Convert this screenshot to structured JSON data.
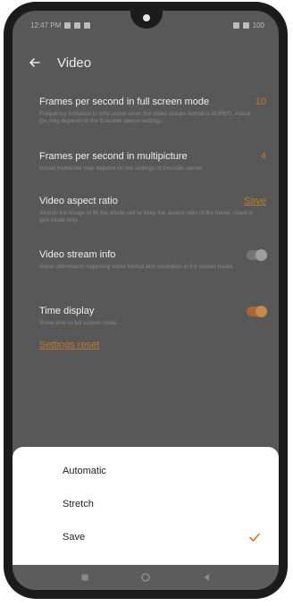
{
  "status_bar": {
    "time": "12:47 PM",
    "battery": "100"
  },
  "header": {
    "title": "Video"
  },
  "settings": [
    {
      "label": "Frames per second in full screen mode",
      "value": "10",
      "description": "Frequency limitation is only active when the video stream format is MJPEG. Actual fps may depend on the Encoder device settings."
    },
    {
      "label": "Frames per second in multipicture",
      "value": "4",
      "description": "Actual framerate may depend on the settings of Encoder server."
    },
    {
      "label": "Video aspect ratio",
      "value": "Save",
      "description": "Stretch the image to fill the whole cell or keep the aspect ratio of the frame. Used in grid mode only."
    },
    {
      "label": "Video stream info",
      "toggle": "off",
      "description": "Show information regarding video format and resolution in full screen mode."
    },
    {
      "label": "Time display",
      "toggle": "on",
      "description": "Show time in full screen mode."
    }
  ],
  "reset_label": "Settings reset",
  "sheet": {
    "options": [
      "Automatic",
      "Stretch",
      "Save"
    ],
    "selected": "Save"
  },
  "colors": {
    "accent": "#c07a2a",
    "scrim": "#585858",
    "sheet": "#ffffff"
  },
  "icons": {
    "back": "arrow-left-icon",
    "check": "check-icon",
    "nav": [
      "square-icon",
      "circle-icon",
      "triangle-icon"
    ]
  }
}
